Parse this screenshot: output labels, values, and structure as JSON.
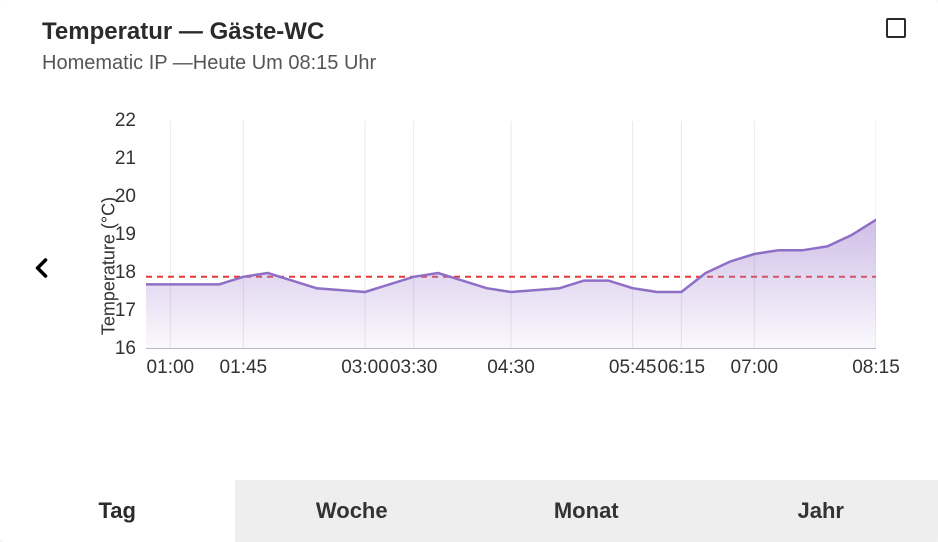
{
  "header": {
    "title": "Temperatur — Gäste-WC",
    "subtitle": "Homematic IP —Heute Um 08:15 Uhr"
  },
  "tabs": [
    {
      "label": "Tag",
      "active": true
    },
    {
      "label": "Woche",
      "active": false
    },
    {
      "label": "Monat",
      "active": false
    },
    {
      "label": "Jahr",
      "active": false
    }
  ],
  "chart_data": {
    "type": "area",
    "title": "Temperatur — Gäste-WC",
    "ylabel": "Temperature (°C)",
    "xlabel": "",
    "ylim": [
      16,
      22
    ],
    "yticks": [
      16,
      17,
      18,
      19,
      20,
      21,
      22
    ],
    "threshold": 17.9,
    "x_tick_labels": [
      "01:00",
      "01:45",
      "03:00",
      "03:30",
      "04:30",
      "05:45",
      "06:15",
      "07:00",
      "08:15"
    ],
    "series": [
      {
        "name": "Temperature",
        "color": "#8e6fc5",
        "points": [
          {
            "t": "00:45",
            "v": 17.7
          },
          {
            "t": "01:00",
            "v": 17.7
          },
          {
            "t": "01:30",
            "v": 17.7
          },
          {
            "t": "01:45",
            "v": 17.9
          },
          {
            "t": "02:00",
            "v": 18.0
          },
          {
            "t": "02:15",
            "v": 17.8
          },
          {
            "t": "02:30",
            "v": 17.6
          },
          {
            "t": "03:00",
            "v": 17.5
          },
          {
            "t": "03:15",
            "v": 17.7
          },
          {
            "t": "03:30",
            "v": 17.9
          },
          {
            "t": "03:45",
            "v": 18.0
          },
          {
            "t": "04:00",
            "v": 17.8
          },
          {
            "t": "04:15",
            "v": 17.6
          },
          {
            "t": "04:30",
            "v": 17.5
          },
          {
            "t": "05:00",
            "v": 17.6
          },
          {
            "t": "05:15",
            "v": 17.8
          },
          {
            "t": "05:30",
            "v": 17.8
          },
          {
            "t": "05:45",
            "v": 17.6
          },
          {
            "t": "06:00",
            "v": 17.5
          },
          {
            "t": "06:15",
            "v": 17.5
          },
          {
            "t": "06:30",
            "v": 18.0
          },
          {
            "t": "06:45",
            "v": 18.3
          },
          {
            "t": "07:00",
            "v": 18.5
          },
          {
            "t": "07:15",
            "v": 18.6
          },
          {
            "t": "07:30",
            "v": 18.6
          },
          {
            "t": "07:45",
            "v": 18.7
          },
          {
            "t": "08:00",
            "v": 19.0
          },
          {
            "t": "08:15",
            "v": 19.4
          }
        ]
      }
    ]
  }
}
